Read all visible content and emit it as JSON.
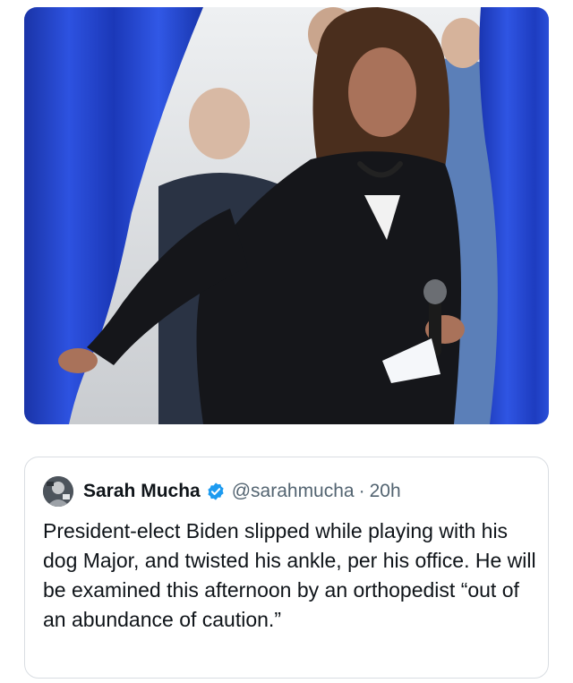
{
  "photo": {
    "icon": "photo-image"
  },
  "tweet": {
    "author": {
      "avatar_icon": "avatar-photo",
      "name": "Sarah Mucha",
      "verified_icon": "verified-badge-icon",
      "handle": "@sarahmucha",
      "separator": "·",
      "time": "20h"
    },
    "text": "President-elect Biden slipped while playing with his dog Major, and twisted his ankle, per his office. He will be examined this afternoon by an orthopedist “out of an abundance of caution.”"
  },
  "colors": {
    "curtain_blue": "#1f3fc4",
    "verified_blue": "#1d9bf0",
    "text_primary": "#0f1419",
    "text_secondary": "#536471",
    "border": "#d9dde2"
  }
}
